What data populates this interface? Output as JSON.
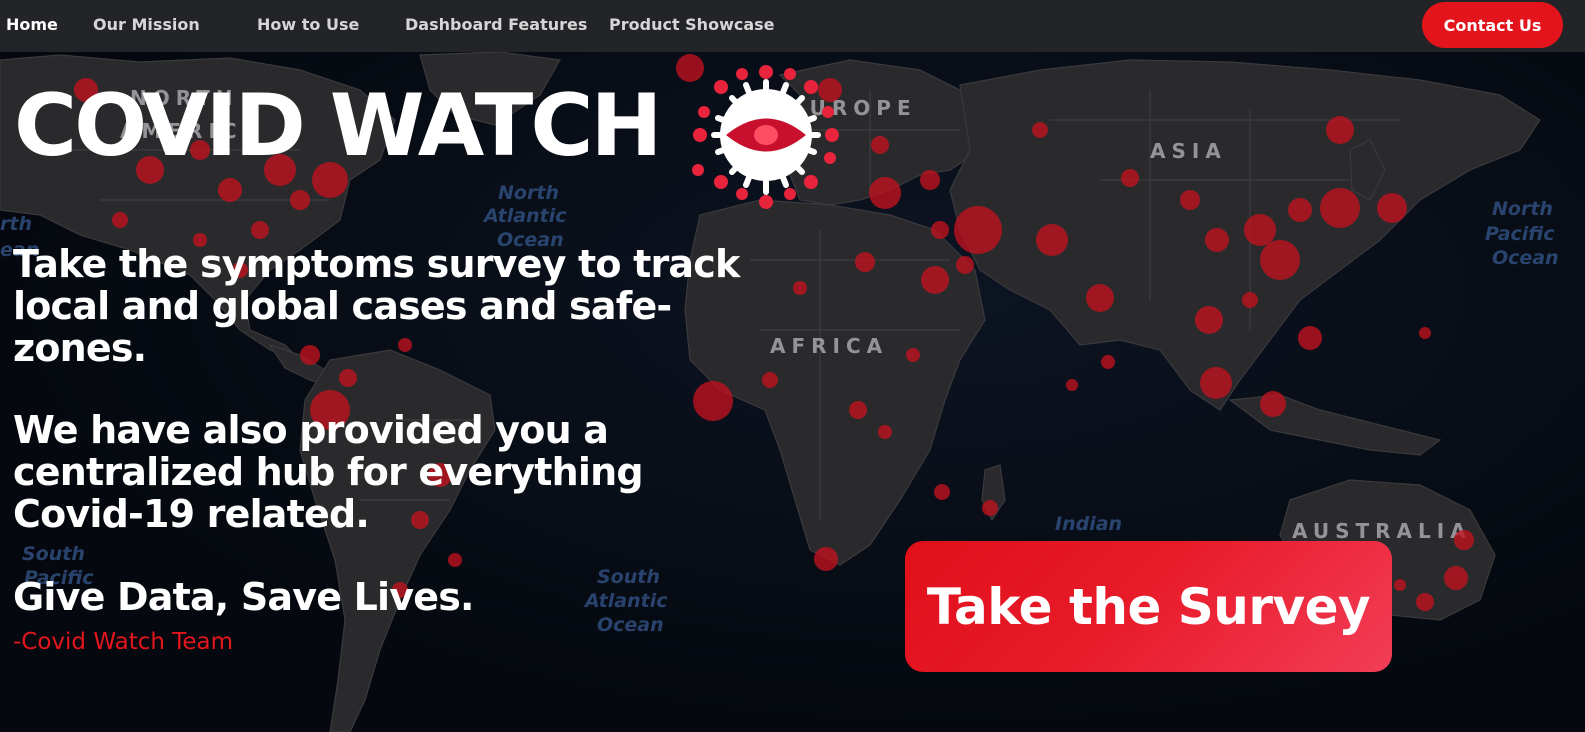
{
  "nav": {
    "items": [
      {
        "label": "Home",
        "active": true
      },
      {
        "label": "Our Mission",
        "active": false
      },
      {
        "label": "How to Use",
        "active": false
      },
      {
        "label": "Dashboard Features",
        "active": false
      },
      {
        "label": "Product Showcase",
        "active": false
      }
    ],
    "contact_label": "Contact Us"
  },
  "hero": {
    "title": "COVID WATCH",
    "logo_icon": "virus-eye-icon",
    "paragraph_1": "Take the symptoms survey to track local and global cases and safe-zones.",
    "paragraph_2": "We have also provided you a centralized hub for everything Covid-19 related.",
    "tagline": "Give Data, Save Lives.",
    "signature": "-Covid Watch Team",
    "cta_label": "Take the Survey"
  },
  "map": {
    "continent_labels": [
      "NORTH AMERICA",
      "EUROPE",
      "ASIA",
      "AFRICA",
      "AUSTRALIA"
    ],
    "ocean_labels": [
      "North Atlantic Ocean",
      "North Pacific Ocean",
      "South Pacific Ocean",
      "South Atlantic Ocean",
      "Indian"
    ]
  },
  "colors": {
    "accent": "#e4141c",
    "navbar": "#232427",
    "background": "#060b14",
    "land": "#2a2a2c",
    "case_dot": "#c1121f",
    "signature_text": "#e3151d"
  }
}
